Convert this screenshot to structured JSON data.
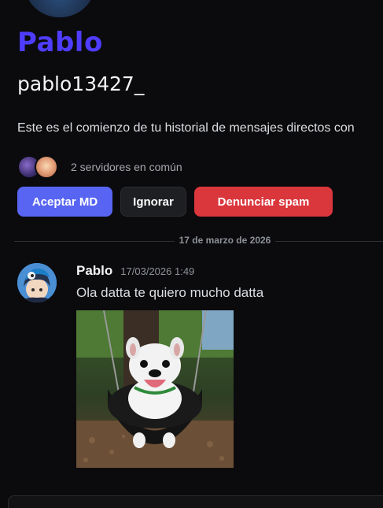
{
  "profile": {
    "display_name": "Pablo",
    "username": "pablo13427_",
    "avatar_icon": "profile-avatar",
    "name_color": "#4e3dff"
  },
  "intro": {
    "text": "Este es el comienzo de tu historial de mensajes directos con"
  },
  "mutual_servers": {
    "text": "2 servidores en común",
    "icons": [
      "server-icon",
      "server-icon"
    ]
  },
  "actions": {
    "accept_label": "Aceptar MD",
    "ignore_label": "Ignorar",
    "spam_label": "Denunciar spam",
    "accept_color": "#5865f2",
    "spam_color": "#da373c"
  },
  "divider": {
    "date_label": "17 de marzo de 2026"
  },
  "message": {
    "author": "Pablo",
    "timestamp": "17/03/2026 1:49",
    "text": "Ola datta te quiero mucho datta",
    "attachment": "bulldog-swing-gif"
  },
  "composer": {
    "placeholder": ""
  }
}
